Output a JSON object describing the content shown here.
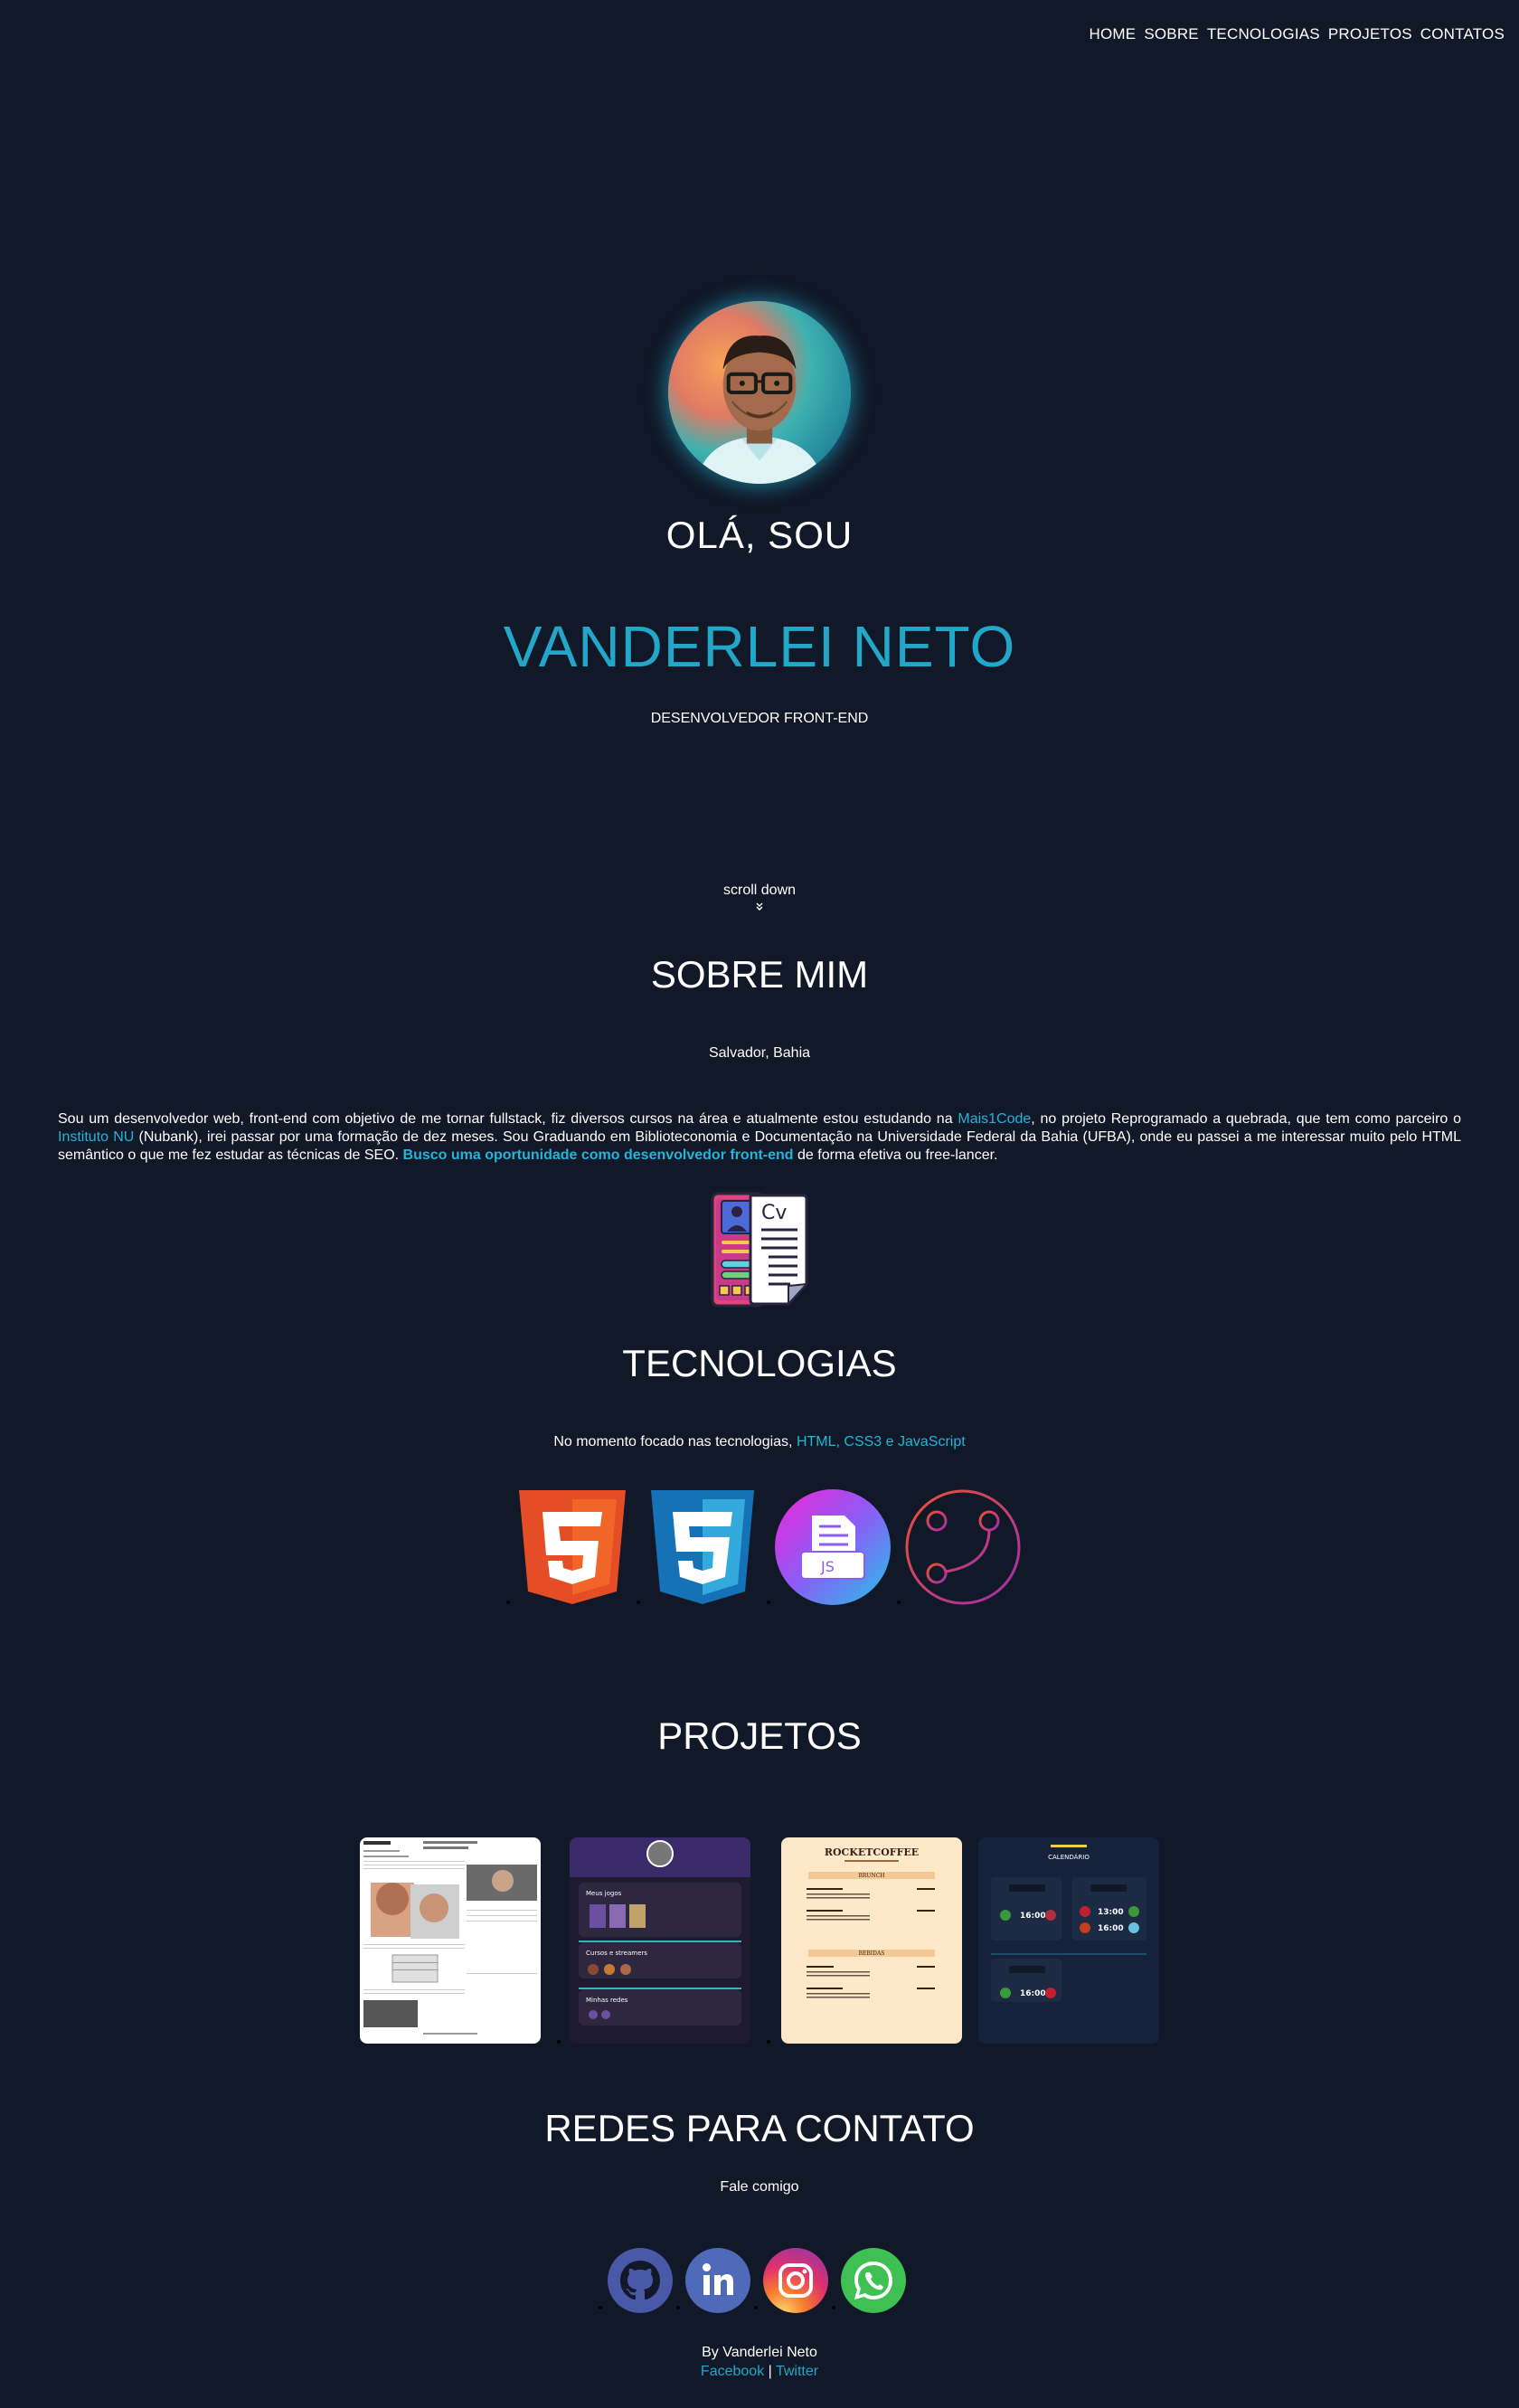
{
  "nav": {
    "items": [
      "HOME",
      "SOBRE",
      "TECNOLOGIAS",
      "PROJETOS",
      "CONTATOS"
    ]
  },
  "hero": {
    "greeting": "OLÁ, SOU",
    "name": "VANDERLEI NETO",
    "role": "DESENVOLVEDOR FRONT-END",
    "scroll": "scroll down",
    "avatar_icon": "avatar-photo"
  },
  "about": {
    "title": "SOBRE MIM",
    "location": "Salvador, Bahia",
    "p1": "Sou um desenvolvedor web, front-end com objetivo de me tornar fullstack, fiz diversos cursos na área e atualmente estou estudando na ",
    "link1": "Mais1Code",
    "p2": ", no projeto Reprogramado a quebrada, que tem como parceiro o ",
    "link2": "Instituto NU",
    "p3": " (Nubank), irei passar por uma formação de dez meses. Sou Graduando em Biblioteconomia e Documentação na Universidade Federal da Bahia (UFBA), onde eu passei a me interessar muito pelo HTML semântico o que me fez estudar as técnicas de SEO. ",
    "highlight": "Busco uma oportunidade como desenvolvedor front-end",
    "p4": " de forma efetiva ou free-lancer.",
    "cv_icon": "cv-icon"
  },
  "tech": {
    "title": "TECNOLOGIAS",
    "intro": "No momento focado nas tecnologias, ",
    "intro_hl": "HTML, CSS3 e JavaScript",
    "items": [
      "html5-icon",
      "css3-icon",
      "javascript-icon",
      "git-icon"
    ]
  },
  "projects": {
    "title": "PROJETOS",
    "items": [
      "project-1",
      "project-2",
      "project-3",
      "project-4"
    ],
    "card2": {
      "t1": "Meus jogos",
      "t2": "Cursos e streamers",
      "t3": "Minhas redes"
    },
    "card3": {
      "brand": "ROCKETCOFFEE",
      "s1": "BRUNCH",
      "s2": "BEBIDAS"
    },
    "card4": {
      "title": "CALENDÁRIO",
      "time1": "16:00",
      "time2": "13:00",
      "time3": "16:00",
      "time4": "16:00"
    }
  },
  "contact": {
    "title": "REDES PARA CONTATO",
    "subtitle": "Fale comigo",
    "items": [
      "github-icon",
      "linkedin-icon",
      "instagram-icon",
      "whatsapp-icon"
    ]
  },
  "footer": {
    "by": "By Vanderlei Neto",
    "link1": "Facebook",
    "sep": "|",
    "link2": "Twitter"
  },
  "colors": {
    "background": "#111827",
    "accent": "#22a7c8"
  }
}
